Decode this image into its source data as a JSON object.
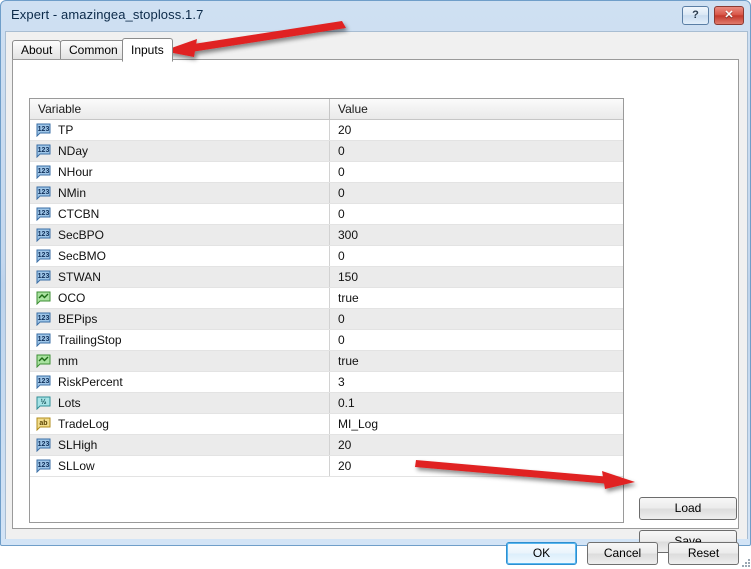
{
  "window": {
    "title": "Expert - amazingea_stoploss.1.7",
    "help_button": "?",
    "close_button": "✕"
  },
  "tabs": [
    {
      "label": "About",
      "active": false
    },
    {
      "label": "Common",
      "active": false
    },
    {
      "label": "Inputs",
      "active": true
    }
  ],
  "grid": {
    "columns": [
      "Variable",
      "Value"
    ],
    "rows": [
      {
        "icon": "integer-icon",
        "variable": "TP",
        "value": "20"
      },
      {
        "icon": "integer-icon",
        "variable": "NDay",
        "value": "0"
      },
      {
        "icon": "integer-icon",
        "variable": "NHour",
        "value": "0"
      },
      {
        "icon": "integer-icon",
        "variable": "NMin",
        "value": "0"
      },
      {
        "icon": "integer-icon",
        "variable": "CTCBN",
        "value": "0"
      },
      {
        "icon": "integer-icon",
        "variable": "SecBPO",
        "value": "300"
      },
      {
        "icon": "integer-icon",
        "variable": "SecBMO",
        "value": "0"
      },
      {
        "icon": "integer-icon",
        "variable": "STWAN",
        "value": "150"
      },
      {
        "icon": "boolean-icon",
        "variable": "OCO",
        "value": "true"
      },
      {
        "icon": "integer-icon",
        "variable": "BEPips",
        "value": "0"
      },
      {
        "icon": "integer-icon",
        "variable": "TrailingStop",
        "value": "0"
      },
      {
        "icon": "boolean-icon",
        "variable": "mm",
        "value": "true"
      },
      {
        "icon": "integer-icon",
        "variable": "RiskPercent",
        "value": "3"
      },
      {
        "icon": "double-icon",
        "variable": "Lots",
        "value": "0.1"
      },
      {
        "icon": "string-icon",
        "variable": "TradeLog",
        "value": "MI_Log"
      },
      {
        "icon": "integer-icon",
        "variable": "SLHigh",
        "value": "20"
      },
      {
        "icon": "integer-icon",
        "variable": "SLLow",
        "value": "20"
      }
    ]
  },
  "side_buttons": {
    "load": "Load",
    "save": "Save"
  },
  "dialog_buttons": {
    "ok": "OK",
    "cancel": "Cancel",
    "reset": "Reset"
  },
  "annotations": {
    "arrow_color": "#E02020",
    "arrow_inputs_tab": "arrow pointing to Inputs tab",
    "arrow_save_button": "arrow pointing to Save button"
  }
}
